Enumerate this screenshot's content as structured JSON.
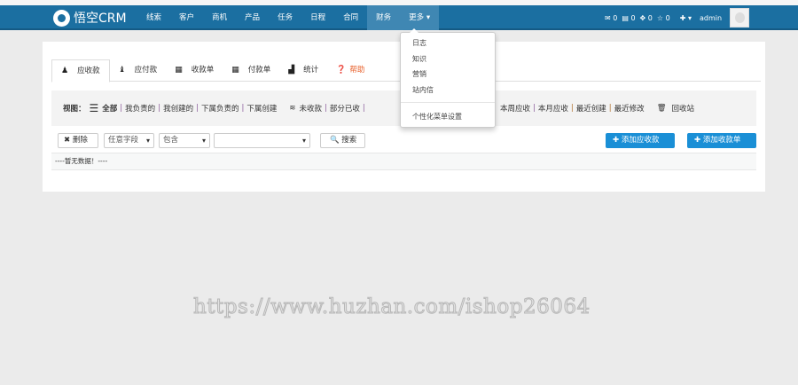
{
  "nav": {
    "brand": "悟空CRM",
    "items": [
      "线索",
      "客户",
      "商机",
      "产品",
      "任务",
      "日程",
      "合同",
      "财务",
      "更多"
    ],
    "active": "财务",
    "counters": [
      {
        "icon": "envelope-icon",
        "value": "0"
      },
      {
        "icon": "list-icon",
        "value": "0"
      },
      {
        "icon": "gear-icon",
        "value": "0"
      },
      {
        "icon": "star-icon",
        "value": "0"
      }
    ],
    "user": "admin"
  },
  "tabs": [
    {
      "label": "应收款",
      "icon": "receivable-icon"
    },
    {
      "label": "应付款",
      "icon": "payable-icon"
    },
    {
      "label": "收款单",
      "icon": "receipt-icon"
    },
    {
      "label": "付款单",
      "icon": "payment-icon"
    },
    {
      "label": "统计",
      "icon": "chart-icon"
    },
    {
      "label": "帮助",
      "icon": "help-icon"
    }
  ],
  "views": {
    "label": "视图：",
    "scope": [
      "全部",
      "我负责的",
      "我创建的",
      "下属负责的",
      "下属创建"
    ],
    "status": [
      "未收款",
      "部分已收"
    ],
    "time": [
      "本周应收",
      "本月应收",
      "最近创建",
      "最近修改"
    ],
    "recycle": "回收站"
  },
  "toolbar": {
    "delete": "删除",
    "field": "任意字段",
    "op": "包含",
    "search_value": "",
    "search": "搜索",
    "add_receivable": "添加应收款",
    "add_receipt": "添加收款单"
  },
  "empty": "----暂无数据！----",
  "more_menu": [
    "日志",
    "知识",
    "营销",
    "站内信",
    "个性化菜单设置"
  ],
  "watermark": "https://www.huzhan.com/ishop26064"
}
